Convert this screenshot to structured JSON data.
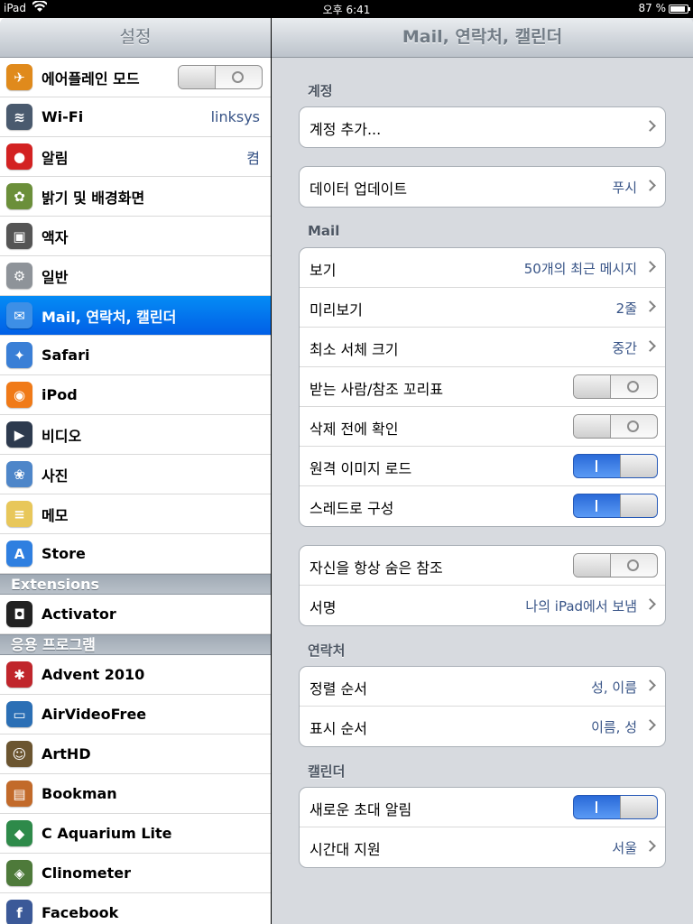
{
  "status": {
    "carrier": "iPad",
    "time": "오후 6:41",
    "battery": "87 %"
  },
  "master": {
    "title": "설정",
    "items": [
      {
        "label": "에어플레인 모드",
        "icon": "airplane-icon",
        "color": "#e08a1c",
        "switch": "off"
      },
      {
        "label": "Wi-Fi",
        "icon": "wifi-icon",
        "color": "#4a5a6e",
        "value": "linksys"
      },
      {
        "label": "알림",
        "icon": "notification-icon",
        "color": "#d32222",
        "value": "켬"
      },
      {
        "label": "밝기 및 배경화면",
        "icon": "flower-icon",
        "color": "#6b8f3a"
      },
      {
        "label": "액자",
        "icon": "picture-frame-icon",
        "color": "#555"
      },
      {
        "label": "일반",
        "icon": "gear-icon",
        "color": "#8e9399"
      },
      {
        "label": "Mail, 연락처, 캘린더",
        "icon": "mail-icon",
        "color": "#3d8fe6",
        "selected": true
      },
      {
        "label": "Safari",
        "icon": "compass-icon",
        "color": "#3a7fd6"
      },
      {
        "label": "iPod",
        "icon": "ipod-icon",
        "color": "#f07a18"
      },
      {
        "label": "비디오",
        "icon": "video-icon",
        "color": "#2d3a4e"
      },
      {
        "label": "사진",
        "icon": "sunflower-icon",
        "color": "#4e86c9"
      },
      {
        "label": "메모",
        "icon": "notes-icon",
        "color": "#e8c75a"
      },
      {
        "label": "Store",
        "icon": "app-store-icon",
        "color": "#2f7fe0"
      }
    ],
    "extensions_header": "Extensions",
    "extensions": [
      {
        "label": "Activator",
        "icon": "activator-icon",
        "color": "#222"
      }
    ],
    "apps_header": "응용 프로그램",
    "apps": [
      {
        "label": "Advent 2010",
        "icon": "advent-calendar-icon",
        "color": "#c0262c"
      },
      {
        "label": "AirVideoFree",
        "icon": "tv-icon",
        "color": "#2b6fb5"
      },
      {
        "label": "ArtHD",
        "icon": "mona-lisa-icon",
        "color": "#6b5530"
      },
      {
        "label": "Bookman",
        "icon": "book-icon",
        "color": "#c26a2a"
      },
      {
        "label": "C Aquarium Lite",
        "icon": "fish-icon",
        "color": "#2e8a4a"
      },
      {
        "label": "Clinometer",
        "icon": "clinometer-icon",
        "color": "#4e7a3a"
      },
      {
        "label": "Facebook",
        "icon": "facebook-icon",
        "color": "#3b5998"
      }
    ]
  },
  "detail": {
    "title": "Mail, 연락처, 캘린더",
    "accounts_header": "계정",
    "add_account": "계정 추가...",
    "fetch": {
      "label": "데이터 업데이트",
      "value": "푸시"
    },
    "mail_header": "Mail",
    "mail": [
      {
        "label": "보기",
        "value": "50개의 최근 메시지"
      },
      {
        "label": "미리보기",
        "value": "2줄"
      },
      {
        "label": "최소 서체 크기",
        "value": "중간"
      },
      {
        "label": "받는 사람/참조 꼬리표",
        "switch": "off"
      },
      {
        "label": "삭제 전에 확인",
        "switch": "off"
      },
      {
        "label": "원격 이미지 로드",
        "switch": "on"
      },
      {
        "label": "스레드로 구성",
        "switch": "on"
      }
    ],
    "mail2": [
      {
        "label": "자신을 항상 숨은 참조",
        "switch": "off"
      },
      {
        "label": "서명",
        "value": "나의 iPad에서 보냄"
      }
    ],
    "contacts_header": "연락처",
    "contacts": [
      {
        "label": "정렬 순서",
        "value": "성, 이름"
      },
      {
        "label": "표시 순서",
        "value": "이름, 성"
      }
    ],
    "calendar_header": "캘린더",
    "calendar": [
      {
        "label": "새로운 초대 알림",
        "switch": "on"
      },
      {
        "label": "시간대 지원",
        "value": "서울"
      }
    ]
  }
}
